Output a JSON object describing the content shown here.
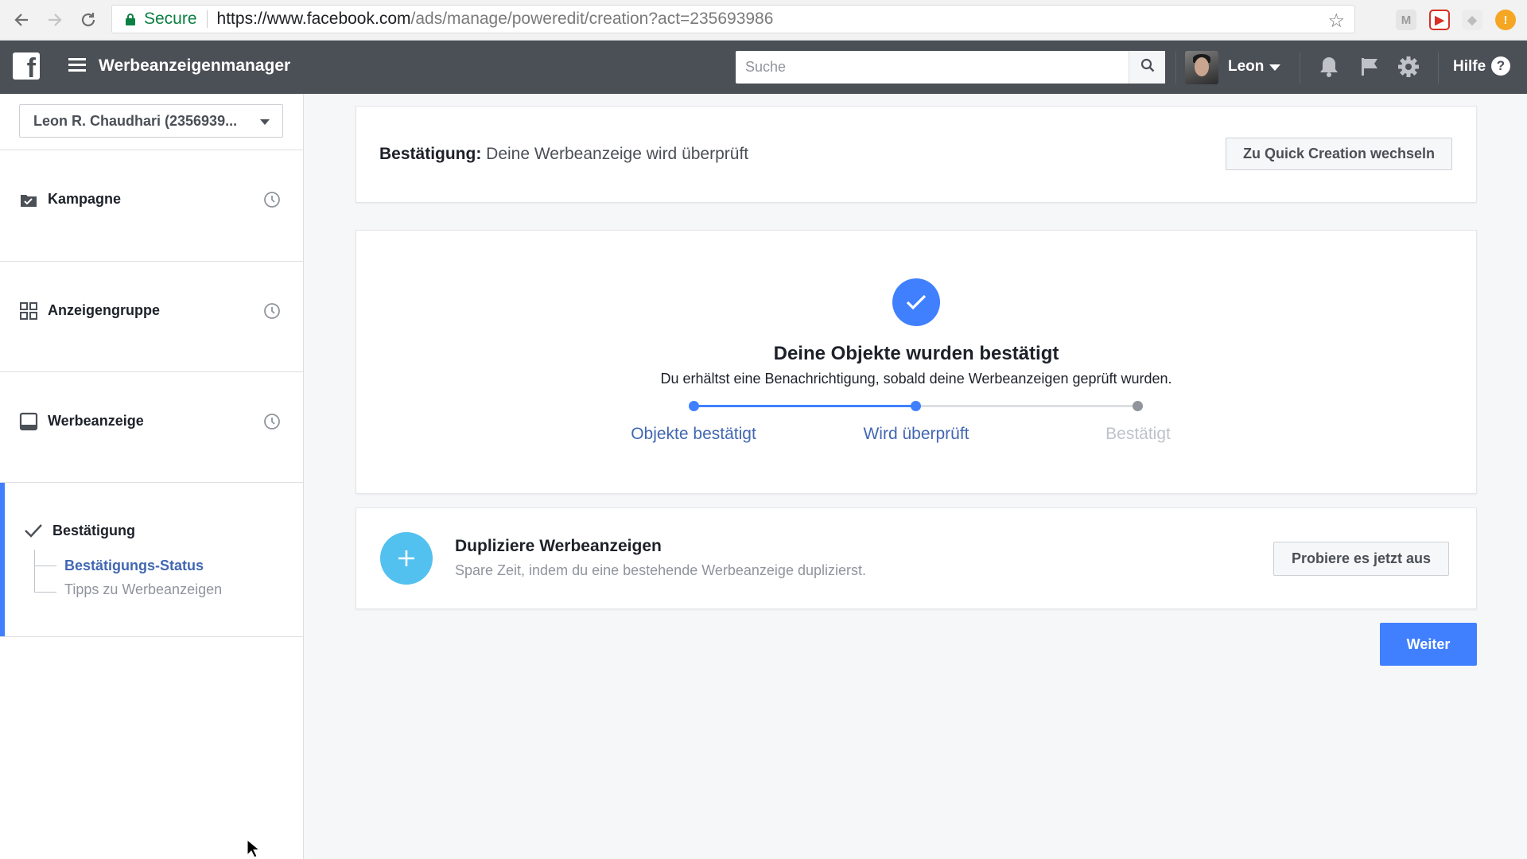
{
  "browser": {
    "secure_label": "Secure",
    "url_host": "https://www.facebook.com",
    "url_path": "/ads/manage/poweredit/creation?act=235693986"
  },
  "topbar": {
    "app_title": "Werbeanzeigenmanager",
    "search": {
      "placeholder": "Suche",
      "value": ""
    },
    "user_name": "Leon",
    "help_label": "Hilfe"
  },
  "sidebar": {
    "account_label": "Leon R. Chaudhari (2356939...",
    "items": [
      {
        "label": "Kampagne",
        "icon": "briefcase-icon"
      },
      {
        "label": "Anzeigengruppe",
        "icon": "grid-icon"
      },
      {
        "label": "Werbeanzeige",
        "icon": "ad-icon"
      }
    ],
    "active_section": {
      "label": "Bestätigung",
      "subitems": [
        {
          "label": "Bestätigungs-Status",
          "active": true
        },
        {
          "label": "Tipps zu Werbeanzeigen",
          "active": false
        }
      ]
    }
  },
  "header_panel": {
    "title_bold": "Bestätigung:",
    "title_rest": " Deine Werbeanzeige wird überprüft",
    "switch_button": "Zu Quick Creation wechseln"
  },
  "status_panel": {
    "heading": "Deine Objekte wurden bestätigt",
    "subtext": "Du erhältst eine Benachrichtigung, sobald deine Werbeanzeigen geprüft wurden.",
    "steps": [
      {
        "label": "Objekte bestätigt",
        "state": "done"
      },
      {
        "label": "Wird überprüft",
        "state": "current"
      },
      {
        "label": "Bestätigt",
        "state": "pending"
      }
    ]
  },
  "duplicate_panel": {
    "title": "Dupliziere Werbeanzeigen",
    "subtitle": "Spare Zeit, indem du eine bestehende Werbeanzeige duplizierst.",
    "button": "Probiere es jetzt aus"
  },
  "footer": {
    "next_button": "Weiter"
  },
  "colors": {
    "accent": "#4080ff",
    "topbar": "#4b4f56",
    "link_active": "#4267b2",
    "plus_circle": "#53c1f0",
    "muted": "#90949c"
  }
}
